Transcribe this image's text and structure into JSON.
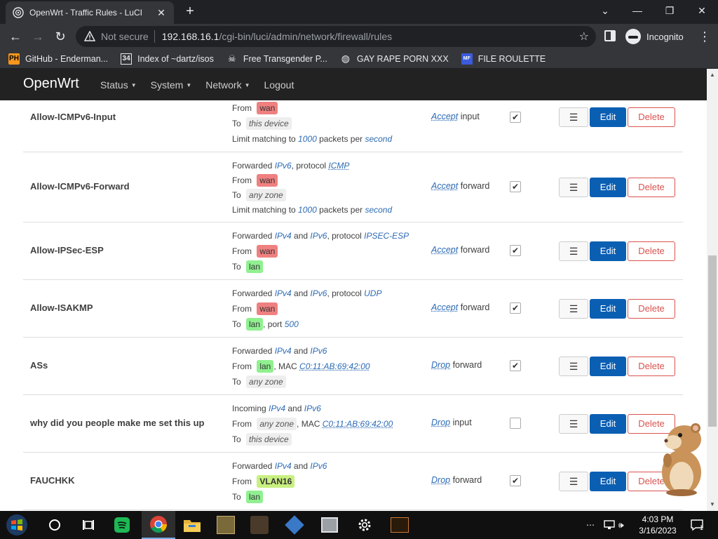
{
  "browser": {
    "tab_title": "OpenWrt - Traffic Rules - LuCI",
    "new_tab": "+",
    "tab_close": "✕",
    "address": {
      "security": "Not secure",
      "host": "192.168.16.1",
      "path": "/cgi-bin/luci/admin/network/firewall/rules"
    },
    "profile": "Incognito",
    "bookmarks": [
      {
        "label": "GitHub - Enderman...",
        "icon": "PH"
      },
      {
        "label": "Index of ~dartz/isos",
        "icon": "34"
      },
      {
        "label": "Free Transgender P...",
        "icon": "bug-icon"
      },
      {
        "label": "GAY RAPE PORN XXX",
        "icon": "globe-icon"
      },
      {
        "label": "FILE ROULETTE",
        "icon": "file-icon"
      }
    ]
  },
  "luci": {
    "brand": "OpenWrt",
    "menu": [
      "Status",
      "System",
      "Network",
      "Logout"
    ]
  },
  "rules": [
    {
      "name": "Allow-ICMPv6-Input",
      "match": [
        [
          {
            "t": "From "
          },
          {
            "zone": "wan",
            "cls": "wan"
          }
        ],
        [
          {
            "t": "To "
          },
          {
            "zone": "this device",
            "cls": "any"
          }
        ],
        [
          {
            "t": "Limit matching to "
          },
          {
            "em": "1000"
          },
          {
            "t": " packets per "
          },
          {
            "em": "second"
          }
        ]
      ],
      "action_verb": "Accept",
      "action_target": " input",
      "enabled": true
    },
    {
      "name": "Allow-ICMPv6-Forward",
      "match": [
        [
          {
            "t": "Forwarded "
          },
          {
            "em": "IPv6"
          },
          {
            "t": ", protocol "
          },
          {
            "emu": "ICMP"
          }
        ],
        [
          {
            "t": "From "
          },
          {
            "zone": "wan",
            "cls": "wan"
          }
        ],
        [
          {
            "t": "To "
          },
          {
            "zone": "any zone",
            "cls": "any"
          }
        ],
        [
          {
            "t": "Limit matching to "
          },
          {
            "em": "1000"
          },
          {
            "t": " packets per "
          },
          {
            "em": "second"
          }
        ]
      ],
      "action_verb": "Accept",
      "action_target": " forward",
      "enabled": true
    },
    {
      "name": "Allow-IPSec-ESP",
      "match": [
        [
          {
            "t": "Forwarded "
          },
          {
            "em": "IPv4"
          },
          {
            "t": " and "
          },
          {
            "em": "IPv6"
          },
          {
            "t": ", protocol "
          },
          {
            "em": "IPSEC-ESP"
          }
        ],
        [
          {
            "t": "From "
          },
          {
            "zone": "wan",
            "cls": "wan"
          }
        ],
        [
          {
            "t": "To "
          },
          {
            "zone": "lan",
            "cls": "lan"
          }
        ]
      ],
      "action_verb": "Accept",
      "action_target": " forward",
      "enabled": true
    },
    {
      "name": "Allow-ISAKMP",
      "match": [
        [
          {
            "t": "Forwarded "
          },
          {
            "em": "IPv4"
          },
          {
            "t": " and "
          },
          {
            "em": "IPv6"
          },
          {
            "t": ", protocol "
          },
          {
            "em": "UDP"
          }
        ],
        [
          {
            "t": "From "
          },
          {
            "zone": "wan",
            "cls": "wan"
          }
        ],
        [
          {
            "t": "To "
          },
          {
            "zone": "lan",
            "cls": "lan"
          },
          {
            "t": ", port "
          },
          {
            "em": "500"
          }
        ]
      ],
      "action_verb": "Accept",
      "action_target": " forward",
      "enabled": true
    },
    {
      "name": "ASs",
      "match": [
        [
          {
            "t": "Forwarded "
          },
          {
            "em": "IPv4"
          },
          {
            "t": " and "
          },
          {
            "em": "IPv6"
          }
        ],
        [
          {
            "t": "From "
          },
          {
            "zone": "lan",
            "cls": "lan"
          },
          {
            "t": ", MAC "
          },
          {
            "emu": "C0:11:AB:69:42:00"
          }
        ],
        [
          {
            "t": "To "
          },
          {
            "zone": "any zone",
            "cls": "any"
          }
        ]
      ],
      "action_verb": "Drop",
      "action_target": " forward",
      "enabled": true
    },
    {
      "name": "why did you people make me set this up",
      "match": [
        [
          {
            "t": "Incoming "
          },
          {
            "em": "IPv4"
          },
          {
            "t": " and "
          },
          {
            "em": "IPv6"
          }
        ],
        [
          {
            "t": "From "
          },
          {
            "zone": "any zone",
            "cls": "any"
          },
          {
            "t": ", MAC "
          },
          {
            "emu": "C0:11:AB:69:42:00"
          }
        ],
        [
          {
            "t": "To "
          },
          {
            "zone": "this device",
            "cls": "any"
          }
        ]
      ],
      "action_verb": "Drop",
      "action_target": " input",
      "enabled": false
    },
    {
      "name": "FAUCHKK",
      "match": [
        [
          {
            "t": "Forwarded "
          },
          {
            "em": "IPv4"
          },
          {
            "t": " and "
          },
          {
            "em": "IPv6"
          }
        ],
        [
          {
            "t": "From "
          },
          {
            "zone": "VLAN16",
            "cls": "vlan"
          }
        ],
        [
          {
            "t": "To "
          },
          {
            "zone": "lan",
            "cls": "lan"
          }
        ]
      ],
      "action_verb": "Drop",
      "action_target": " forward",
      "enabled": true
    }
  ],
  "buttons": {
    "drag": "☰",
    "edit": "Edit",
    "delete": "Delete"
  },
  "taskbar": {
    "time": "4:03 PM",
    "date": "3/16/2023",
    "notifications": "1"
  },
  "colors": {
    "edit_button": "#0b5fb3",
    "delete_border": "#d9534f",
    "zone_wan": "#f08080",
    "zone_lan": "#90f090",
    "zone_vlan": "#c8f080",
    "link": "#2d6bb5",
    "luci_header": "#222222",
    "chrome_dark": "#202124"
  }
}
